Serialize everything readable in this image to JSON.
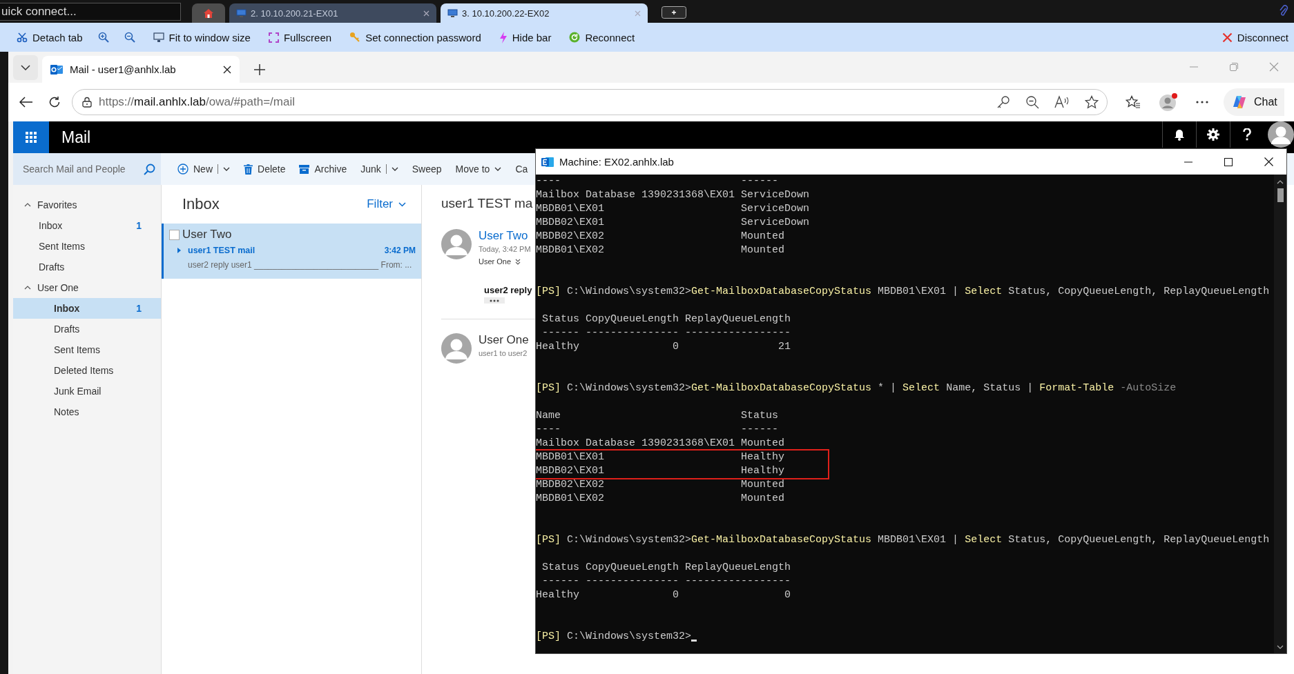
{
  "remote_app": {
    "quick_connect": {
      "placeholder": "uick connect..."
    },
    "tabs": [
      {
        "kind": "home",
        "selected": false
      },
      {
        "kind": "session",
        "label": "2. 10.10.200.21-EX01",
        "selected": false
      },
      {
        "kind": "session",
        "label": "3. 10.10.200.22-EX02",
        "selected": true
      }
    ],
    "toolbar": [
      {
        "kind": "detach",
        "label": "Detach tab"
      },
      {
        "kind": "zoom_in"
      },
      {
        "kind": "zoom_out"
      },
      {
        "kind": "fit",
        "label": "Fit to window size"
      },
      {
        "kind": "fullscreen",
        "label": "Fullscreen"
      },
      {
        "kind": "password",
        "label": "Set connection password"
      },
      {
        "kind": "hide",
        "label": "Hide bar"
      },
      {
        "kind": "reconnect",
        "label": "Reconnect"
      }
    ],
    "disconnect": "Disconnect"
  },
  "browser": {
    "tab_title": "Mail - user1@anhlx.lab",
    "url": {
      "scheme": "https://",
      "host": "mail.anhlx.lab",
      "path": "/owa/#path=/mail"
    },
    "chat_label": "Chat"
  },
  "owa": {
    "app_title": "Mail",
    "search": {
      "placeholder": "Search Mail and People"
    },
    "commands": [
      {
        "kind": "new",
        "label": "New"
      },
      {
        "kind": "delete",
        "label": "Delete"
      },
      {
        "kind": "archive",
        "label": "Archive"
      },
      {
        "kind": "junk",
        "label": "Junk"
      },
      {
        "kind": "plain",
        "label": "Sweep"
      },
      {
        "kind": "move",
        "label": "Move to"
      },
      {
        "kind": "plain",
        "label": "Ca"
      }
    ],
    "folders": [
      {
        "label": "Favorites",
        "expanded": true,
        "children": [
          {
            "label": "Inbox",
            "count": "1",
            "selected": false
          },
          {
            "label": "Sent Items",
            "selected": false
          },
          {
            "label": "Drafts",
            "selected": false
          }
        ]
      },
      {
        "label": "User One",
        "expanded": true,
        "children": [
          {
            "label": "Inbox",
            "count": "1",
            "selected": true
          },
          {
            "label": "Drafts",
            "selected": false
          },
          {
            "label": "Sent Items",
            "selected": false
          },
          {
            "label": "Deleted Items",
            "selected": false
          },
          {
            "label": "Junk Email",
            "selected": false
          },
          {
            "label": "Notes",
            "selected": false
          }
        ]
      }
    ],
    "list": {
      "title": "Inbox",
      "filter": "Filter",
      "messages": [
        {
          "sender": "User Two",
          "subject": "user1 TEST mail",
          "time": "3:42 PM",
          "preview": "user2 reply user1 ___________________________ From: ...",
          "selected": true,
          "checked": false
        }
      ]
    },
    "reading": {
      "subject": "user1 TEST ma",
      "messages": [
        {
          "kind": "expanded",
          "sender": "User Two",
          "date": "Today, 3:42 PM",
          "to": "User One",
          "body": "user2 reply"
        },
        {
          "kind": "collapsed",
          "sender": "User One",
          "snippet": "user1 to user2"
        }
      ]
    }
  },
  "terminal": {
    "title": "Machine: EX02.anhlx.lab",
    "cursor": true,
    "lines": [
      {
        "kind": "output",
        "text": "----                             ------"
      },
      {
        "kind": "output",
        "text": "Mailbox Database 1390231368\\EX01 ServiceDown"
      },
      {
        "kind": "output",
        "text": "MBDB01\\EX01                      ServiceDown"
      },
      {
        "kind": "output",
        "text": "MBDB02\\EX01                      ServiceDown"
      },
      {
        "kind": "output",
        "text": "MBDB02\\EX02                      Mounted"
      },
      {
        "kind": "output",
        "text": "MBDB01\\EX02                      Mounted"
      },
      {
        "kind": "blank"
      },
      {
        "kind": "blank"
      },
      {
        "kind": "prompt",
        "segments": [
          {
            "kind": "prompt",
            "text": "[PS]"
          },
          {
            "kind": "path",
            "text": " C:\\Windows\\system32>"
          },
          {
            "kind": "command",
            "text": "Get-MailboxDatabaseCopyStatus"
          },
          {
            "kind": "arg",
            "text": " MBDB01\\EX01 | "
          },
          {
            "kind": "command",
            "text": "Select"
          },
          {
            "kind": "arg",
            "text": " Status, CopyQueueLength, ReplayQueueLength"
          }
        ]
      },
      {
        "kind": "blank"
      },
      {
        "kind": "output",
        "text": " Status CopyQueueLength ReplayQueueLength"
      },
      {
        "kind": "output",
        "text": " ------ --------------- -----------------"
      },
      {
        "kind": "output",
        "text": "Healthy               0                21"
      },
      {
        "kind": "blank"
      },
      {
        "kind": "blank"
      },
      {
        "kind": "prompt",
        "segments": [
          {
            "kind": "prompt",
            "text": "[PS]"
          },
          {
            "kind": "path",
            "text": " C:\\Windows\\system32>"
          },
          {
            "kind": "command",
            "text": "Get-MailboxDatabaseCopyStatus"
          },
          {
            "kind": "arg",
            "text": " * | "
          },
          {
            "kind": "command",
            "text": "Select"
          },
          {
            "kind": "arg",
            "text": " Name, Status | "
          },
          {
            "kind": "command",
            "text": "Format-Table"
          },
          {
            "kind": "param",
            "text": " -AutoSize"
          }
        ]
      },
      {
        "kind": "blank"
      },
      {
        "kind": "output",
        "text": "Name                             Status"
      },
      {
        "kind": "output",
        "text": "----                             ------"
      },
      {
        "kind": "output",
        "text": "Mailbox Database 1390231368\\EX01 Mounted"
      },
      {
        "kind": "highlight_group",
        "lines": [
          "MBDB01\\EX01                      Healthy",
          "MBDB02\\EX01                      Healthy"
        ]
      },
      {
        "kind": "output",
        "text": "MBDB02\\EX02                      Mounted"
      },
      {
        "kind": "output",
        "text": "MBDB01\\EX02                      Mounted"
      },
      {
        "kind": "blank"
      },
      {
        "kind": "blank"
      },
      {
        "kind": "prompt",
        "segments": [
          {
            "kind": "prompt",
            "text": "[PS]"
          },
          {
            "kind": "path",
            "text": " C:\\Windows\\system32>"
          },
          {
            "kind": "command",
            "text": "Get-MailboxDatabaseCopyStatus"
          },
          {
            "kind": "arg",
            "text": " MBDB01\\EX01 | "
          },
          {
            "kind": "command",
            "text": "Select"
          },
          {
            "kind": "arg",
            "text": " Status, CopyQueueLength, ReplayQueueLength"
          }
        ]
      },
      {
        "kind": "blank"
      },
      {
        "kind": "output",
        "text": " Status CopyQueueLength ReplayQueueLength"
      },
      {
        "kind": "output",
        "text": " ------ --------------- -----------------"
      },
      {
        "kind": "output",
        "text": "Healthy               0                 0"
      },
      {
        "kind": "blank"
      },
      {
        "kind": "blank"
      },
      {
        "kind": "prompt",
        "segments": [
          {
            "kind": "prompt",
            "text": "[PS]"
          },
          {
            "kind": "path",
            "text": " C:\\Windows\\system32>"
          }
        ]
      }
    ]
  }
}
